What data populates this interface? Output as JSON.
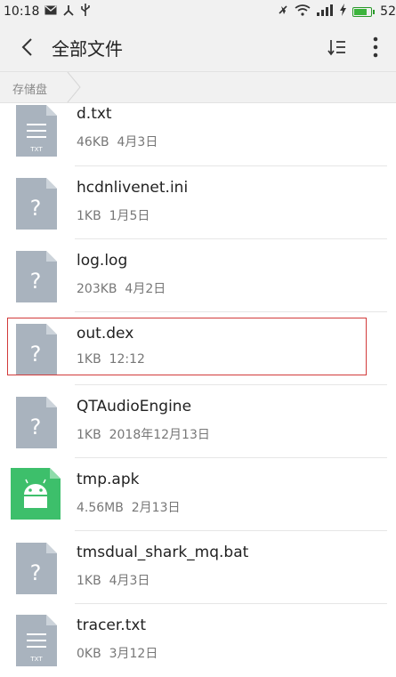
{
  "status_bar": {
    "time": "10:18",
    "battery_level": "52",
    "icons": [
      "mail-icon",
      "usb-icon",
      "usb-debug-icon",
      "mute-icon",
      "wifi-icon",
      "signal-icon",
      "charging-icon",
      "battery-icon"
    ]
  },
  "app_bar": {
    "title": "全部文件",
    "back_icon": "back-arrow-icon",
    "sort_icon": "sort-icon",
    "more_icon": "more-vertical-icon"
  },
  "breadcrumb": {
    "items": [
      "存储盘"
    ]
  },
  "files": [
    {
      "name": "d.txt",
      "size": "46KB",
      "date": "4月3日",
      "type": "txt"
    },
    {
      "name": "hcdnlivenet.ini",
      "size": "1KB",
      "date": "1月5日",
      "type": "unknown"
    },
    {
      "name": "log.log",
      "size": "203KB",
      "date": "4月2日",
      "type": "unknown"
    },
    {
      "name": "out.dex",
      "size": "1KB",
      "date": "12:12",
      "type": "unknown",
      "selected": true
    },
    {
      "name": "QTAudioEngine",
      "size": "1KB",
      "date": "2018年12月13日",
      "type": "unknown"
    },
    {
      "name": "tmp.apk",
      "size": "4.56MB",
      "date": "2月13日",
      "type": "apk"
    },
    {
      "name": "tmsdual_shark_mq.bat",
      "size": "1KB",
      "date": "4月3日",
      "type": "unknown"
    },
    {
      "name": "tracer.txt",
      "size": "0KB",
      "date": "3月12日",
      "type": "txt"
    }
  ],
  "colors": {
    "bar_bg": "#f1f1f1",
    "icon_gray": "#a9b3be",
    "apk_green": "#3dbf6b",
    "highlight": "#d23b3b"
  }
}
